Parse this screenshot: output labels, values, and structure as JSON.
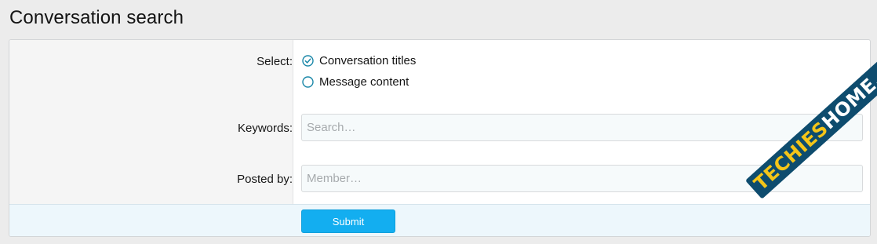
{
  "page": {
    "title": "Conversation search"
  },
  "form": {
    "select": {
      "label": "Select:",
      "options": [
        {
          "label": "Conversation titles",
          "checked": true
        },
        {
          "label": "Message content",
          "checked": false
        }
      ]
    },
    "keywords": {
      "label": "Keywords:",
      "placeholder": "Search…",
      "value": ""
    },
    "posted_by": {
      "label": "Posted by:",
      "placeholder": "Member…",
      "value": ""
    },
    "submit_label": "Submit"
  },
  "watermark": {
    "part1": "TECHIES",
    "part2": "HOME.COM"
  },
  "colors": {
    "accent": "#13aef0",
    "radio": "#1a87a8",
    "submit_bg": "#edf7fc"
  }
}
